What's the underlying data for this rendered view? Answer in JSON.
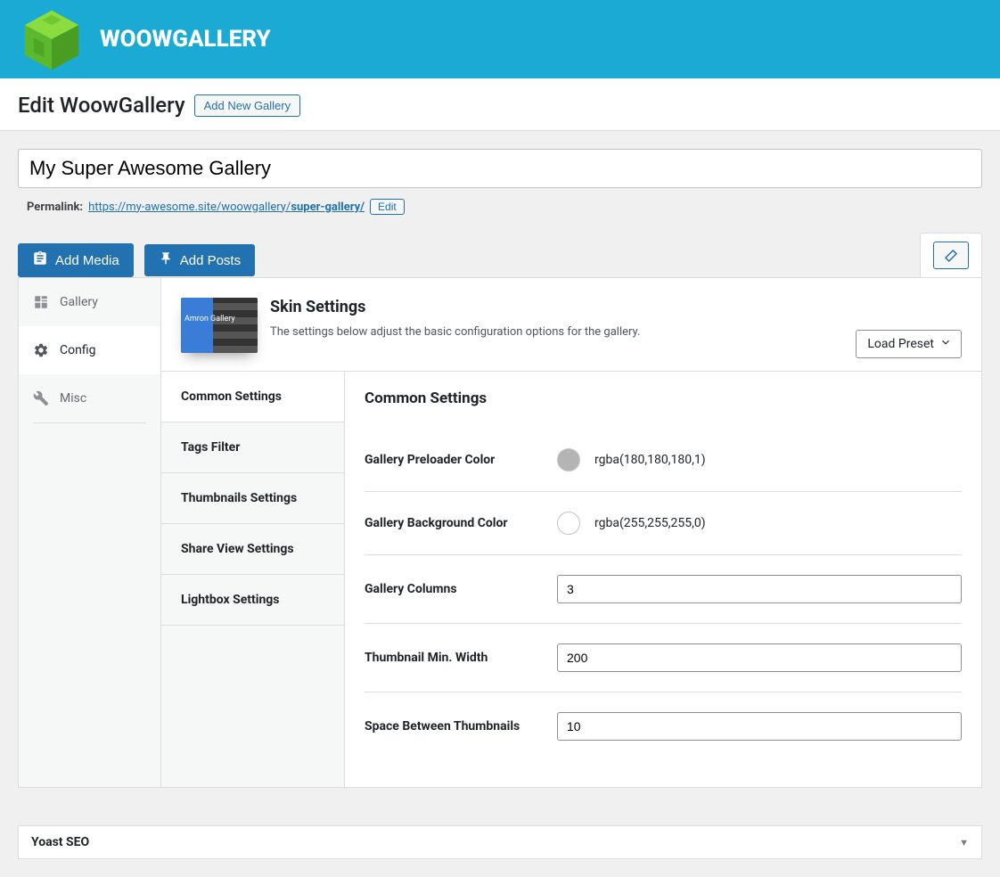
{
  "brand": "WOOWGALLERY",
  "header": {
    "title": "Edit WoowGallery",
    "add_btn": "Add New Gallery"
  },
  "gallery_title": "My Super Awesome Gallery",
  "permalink": {
    "label": "Permalink:",
    "base": "https://my-awesome.site/woowgallery/",
    "slug": "super-gallery/",
    "edit_btn": "Edit"
  },
  "toolbar": {
    "add_media": "Add Media",
    "add_posts": "Add Posts"
  },
  "sidebar": {
    "gallery": "Gallery",
    "config": "Config",
    "misc": "Misc"
  },
  "skin": {
    "thumb_label": "Amron Gallery",
    "title": "Skin Settings",
    "desc": "The settings below adjust the basic configuration options for the gallery.",
    "preset_label": "Load Preset"
  },
  "tabs": {
    "common": "Common Settings",
    "tags_filter": "Tags Filter",
    "thumbnails": "Thumbnails Settings",
    "share_view": "Share View Settings",
    "lightbox": "Lightbox Settings"
  },
  "section_title": "Common Settings",
  "fields": {
    "preloader": {
      "label": "Gallery Preloader Color",
      "value": "rgba(180,180,180,1)",
      "swatch": "#b4b4b4"
    },
    "bgcolor": {
      "label": "Gallery Background Color",
      "value": "rgba(255,255,255,0)",
      "swatch": "#ffffff"
    },
    "columns": {
      "label": "Gallery Columns",
      "value": "3"
    },
    "thumb_min_width": {
      "label": "Thumbnail Min. Width",
      "value": "200"
    },
    "space_between": {
      "label": "Space Between Thumbnails",
      "value": "10"
    }
  },
  "yoast": "Yoast SEO"
}
